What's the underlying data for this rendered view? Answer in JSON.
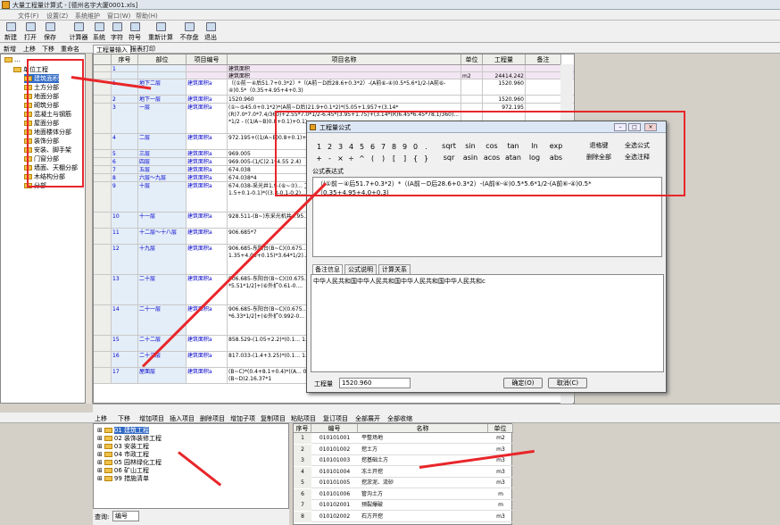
{
  "window": {
    "title": "大量工程量计算式 - [德州名宇大厦0001.xls]"
  },
  "menu": [
    "文件(F)",
    "设置(Z)",
    "系统维护",
    "窗口(W)",
    "帮助(H)"
  ],
  "toolbar": [
    "新建",
    "打开",
    "保存",
    "计算器",
    "系统",
    "字符",
    "符号",
    "重新计算",
    "不存盘",
    "退出"
  ],
  "subbar": [
    "新增",
    "上移",
    "下移",
    "重命名"
  ],
  "main_tabs": [
    "工程量输入",
    "报表打印"
  ],
  "left_tree": {
    "root": "单位工程",
    "items": [
      "建筑面积",
      "土方分部",
      "地面分部",
      "砌筑分部",
      "混凝土与钢筋",
      "屋面分部",
      "地面楼体分部",
      "装饰分部",
      "安装、脚手架",
      "门窗分部",
      "墙面、天棚分部",
      "木结构分部",
      "分部"
    ]
  },
  "grid": {
    "headers": [
      "序号",
      "部位",
      "项目编号",
      "项目名称",
      "单位",
      "工程量",
      "备注"
    ],
    "rows": [
      {
        "no": "1",
        "part": "",
        "code": "",
        "name": "建筑面积",
        "unit": "",
        "qty": "",
        "note": ""
      },
      {
        "no": "",
        "part": "",
        "code": "",
        "name": "建筑面积",
        "unit": "m2",
        "qty": "24414.242",
        "note": ""
      },
      {
        "no": "1",
        "part": "地下二层",
        "code": "建筑面积a",
        "name": "（(①前－④后51.7+0.3*2）*（(A前－D后28.6+0.3*2）-(A前⑥-④)0.5*5.6*1/2-(A前⑥-④)0.5*（0.35+4.95+4+0.3)",
        "unit": "",
        "qty": "1520.960",
        "note": ""
      },
      {
        "no": "2",
        "part": "地下一层",
        "code": "建筑面积a",
        "name": "1520.960",
        "unit": "",
        "qty": "1520.960",
        "note": ""
      },
      {
        "no": "3",
        "part": "一层",
        "code": "建筑面积a",
        "name": "(①~⑤45.0+0.1*2)*(A前~D后)21.9+0.1*2)*(5.05+1.957+(3.14*(R)7.0*7.0*7.4/360)+2.55*7.0*1/2-6.45*(3.95+1.75)+(3.14*(R)6.45*6.45*78.1/360)... *1/2 - ((1/A~B)0.8+0.1)+0.1)",
        "unit": "",
        "qty": "972.195",
        "note": ""
      },
      {
        "no": "4",
        "part": "二层",
        "code": "建筑面积a",
        "name": "972.195+((1/A~B)0.8+0.1)+0.05+... 4.95+0.1)(0.45)*1/2-1.8*(0.675+0.9)",
        "unit": "",
        "qty": "",
        "note": ""
      },
      {
        "no": "5",
        "part": "三层",
        "code": "建筑面积a",
        "name": "969.005",
        "unit": "",
        "qty": "",
        "note": ""
      },
      {
        "no": "6",
        "part": "四层",
        "code": "建筑面积a",
        "name": "969.005-(1/C)2.1*4.55 2.4)",
        "unit": "",
        "qty": "",
        "note": ""
      },
      {
        "no": "7",
        "part": "五层",
        "code": "建筑面积a",
        "name": "674.038",
        "unit": "",
        "qty": "",
        "note": ""
      },
      {
        "no": "8",
        "part": "六层～九层",
        "code": "建筑面积a",
        "name": "674.038*4",
        "unit": "",
        "qty": "",
        "note": ""
      },
      {
        "no": "9",
        "part": "十层",
        "code": "建筑面积a",
        "name": "674.038-采光井1.9-(⑥~⑦)... 卫生间2.4*1.8+西阳台(B~C)... +1/4*(R)2.95*2.95*3.14*1/2 1.5+0.1-0.1)*((3.3-0.1-0.2)... (3.3-0.2)*1/2*2",
        "unit": "",
        "qty": "",
        "note": ""
      },
      {
        "no": "10",
        "part": "十一层",
        "code": "建筑面积a",
        "name": "928.511-(B~)东采光机井4.95... 3.3-2.95)+1/4*(R)2.95*2.95...",
        "unit": "",
        "qty": "",
        "note": ""
      },
      {
        "no": "11",
        "part": "十二层～十八层",
        "code": "建筑面积a",
        "name": "906.685*7",
        "unit": "",
        "qty": "",
        "note": ""
      },
      {
        "no": "12",
        "part": "十九层",
        "code": "建筑面积a",
        "name": "906.685-东阳台(B~C)(0.675... (①~④阳台2.4-0.1)*(⑦~... 0.15+0.888+0.1)*0.5+0.9)... 1.35+4.06+0.15)*3.64*1/2)...",
        "unit": "",
        "qty": "",
        "note": ""
      },
      {
        "no": "13",
        "part": "二十层",
        "code": "建筑面积a",
        "name": "906.685-东阳台(B~C)((0.675... (⑦~⑥阳台2.4-0.1)*(B~... (0.3+1.8+0.6+0.1)-[(⑥~... *5.51*1/2]+(⑥外扩0.61-0....",
        "unit": "",
        "qty": "",
        "note": ""
      },
      {
        "no": "14",
        "part": "二十一层",
        "code": "建筑面积a",
        "name": "906.685-东阳台(B~C)(0.675... (⑦~⑥阳台2.4-0.1)*(B~... (0.75+1.8+0.15+0.1)-[(⑥... *6.33*1/2]+(⑥外扩0.992-0... 0.75*2+1.8-0.1*2)",
        "unit": "",
        "qty": "",
        "note": ""
      },
      {
        "no": "15",
        "part": "二十二层",
        "code": "建筑面积a",
        "name": "858.529-(1.05+2.2)*(0.1... 1.374-0.992)*3.65+(1.1...",
        "unit": "",
        "qty": "",
        "note": ""
      },
      {
        "no": "16",
        "part": "二十三层",
        "code": "建筑面积a",
        "name": "817.033-(1.4+3.25)*(0.1... 1.756-1.374)*3.65-(1/⑥~⑥...",
        "unit": "",
        "qty": "",
        "note": ""
      },
      {
        "no": "17",
        "part": "屋面层",
        "code": "建筑面积a",
        "name": "(B~C)*(0.4+8.1+0.4)*((A... 0.175+4.95+0.1)*4/A~1/A)-0.5*(6.1)*0.175+2.4*(D)(B~D)2.16.37*1",
        "unit": "",
        "qty": "",
        "note": ""
      }
    ]
  },
  "bottom_toolbar": [
    "上移",
    "下移",
    "增加项目",
    "插入项目",
    "删除项目",
    "增加子项",
    "复制项目",
    "粘贴项目",
    "复订项目",
    "全部展开",
    "全部收缩"
  ],
  "bottom_tree": [
    "01 建筑工程",
    "02 装饰装修工程",
    "03 安装工程",
    "04 市政工程",
    "05 园林绿化工程",
    "06 矿山工程",
    "99 措施清单"
  ],
  "search": {
    "label": "查询:",
    "value": "编号"
  },
  "bottom_table": {
    "headers": [
      "序号",
      "编号",
      "名称",
      "单位"
    ],
    "rows": [
      {
        "no": "1",
        "code": "010101001",
        "name": "平整场地",
        "unit": "m2"
      },
      {
        "no": "2",
        "code": "010101002",
        "name": "挖土方",
        "unit": "m3"
      },
      {
        "no": "3",
        "code": "010101003",
        "name": "挖基础土方",
        "unit": "m3"
      },
      {
        "no": "4",
        "code": "010101004",
        "name": "冻土开挖",
        "unit": "m3"
      },
      {
        "no": "5",
        "code": "010101005",
        "name": "挖淤泥、流砂",
        "unit": "m3"
      },
      {
        "no": "6",
        "code": "010101006",
        "name": "管沟土方",
        "unit": "m"
      },
      {
        "no": "7",
        "code": "010102001",
        "name": "预裂爆破",
        "unit": "m"
      },
      {
        "no": "8",
        "code": "010102002",
        "name": "石方开挖",
        "unit": "m3"
      }
    ]
  },
  "dialog": {
    "title": "工程量公式",
    "keys_digits": [
      "1",
      "2",
      "3",
      "4",
      "5",
      "6",
      "7",
      "8",
      "9",
      "0",
      "."
    ],
    "keys_ops": [
      "+",
      "-",
      "×",
      "÷",
      "^",
      "(",
      ")",
      "[",
      "]",
      "{",
      "}"
    ],
    "keys_fn_top": [
      "sqrt",
      "sin",
      "cos",
      "tan",
      "ln",
      "exp"
    ],
    "keys_fn_bot": [
      "sqr",
      "asin",
      "acos",
      "atan",
      "log",
      "abs"
    ],
    "btn_backspace": "退格键",
    "btn_select_all": "全选公式",
    "btn_delete_all": "删除全部",
    "btn_select_note": "全选注释",
    "formula_label": "公式表达式",
    "formula": "（(①前－④后51.7+0.3*2）*（(A前－D后28.6+0.3*2）-(A前⑥-④)0.5*5.6*1/2-(A前⑥-④)0.5*（0.35+4.95+4.0+0.3)",
    "tabs": [
      "备注信息",
      "公式说明",
      "计算关系"
    ],
    "note": "中华人民共和国中华人民共和国中华人民共和国中华人民共和c",
    "qty_label": "工程量",
    "qty_value": "1520.960",
    "ok": "确定(O)",
    "cancel": "取消(C)"
  }
}
